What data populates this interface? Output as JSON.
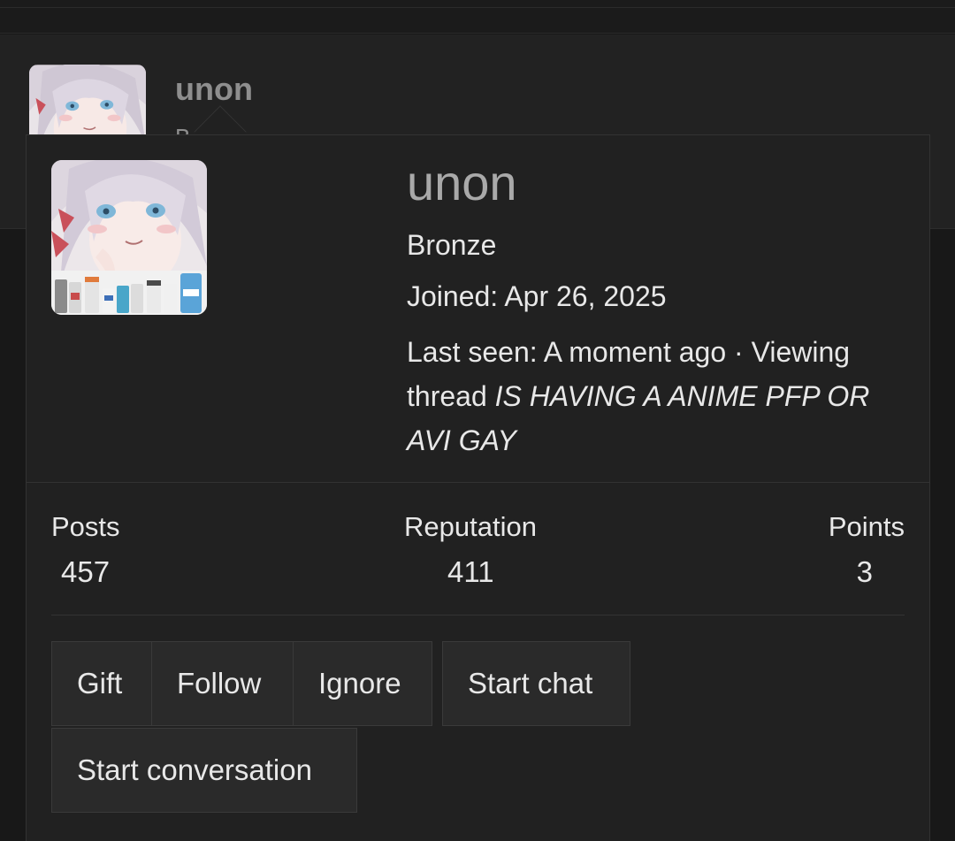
{
  "background": {
    "username": "unon",
    "subtitle_fragment": "B"
  },
  "card": {
    "username": "unon",
    "user_title": "Bronze",
    "joined_label": "Joined:",
    "joined_date": "Apr 26, 2025",
    "last_seen_label": "Last seen:",
    "last_seen_value": "A moment ago",
    "separator": "·",
    "activity_prefix": "Viewing thread",
    "activity_thread": "IS HAVING A ANIME PFP OR AVI GAY",
    "avatar_icon": "anime-avatar-image"
  },
  "stats": [
    {
      "label": "Posts",
      "value": "457"
    },
    {
      "label": "Reputation",
      "value": "411"
    },
    {
      "label": "Points",
      "value": "3"
    }
  ],
  "buttons": {
    "gift": "Gift",
    "follow": "Follow",
    "ignore": "Ignore",
    "start_chat": "Start chat",
    "start_conversation": "Start conversation"
  },
  "colors": {
    "background": "#181818",
    "card": "#212121",
    "button": "#2a2a2a",
    "username": "#a9a9a9",
    "text": "#e8e8e8"
  }
}
